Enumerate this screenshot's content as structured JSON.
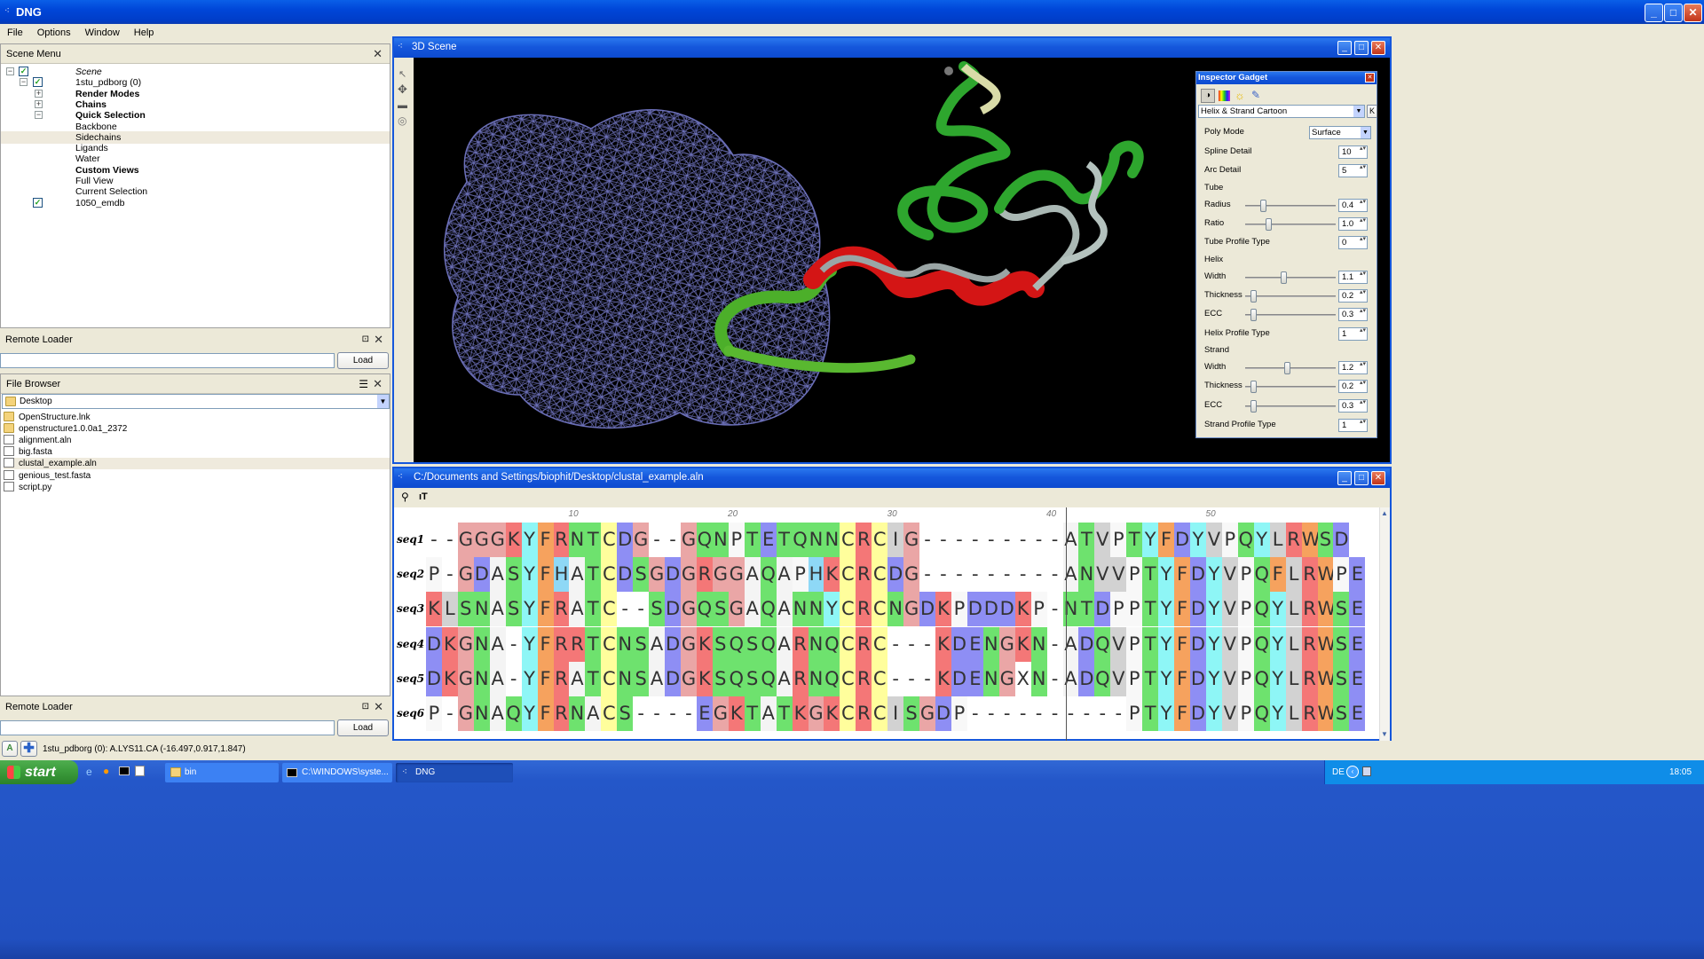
{
  "app_title": "DNG",
  "menu": [
    "File",
    "Options",
    "Window",
    "Help"
  ],
  "scene_menu": {
    "title": "Scene Menu",
    "items": [
      {
        "label": "Scene",
        "style": "italic",
        "indent": 0,
        "expander": "−",
        "check": true
      },
      {
        "label": "1stu_pdborg (0)",
        "style": "normal",
        "indent": 1,
        "expander": "−",
        "check": true
      },
      {
        "label": "Render Modes",
        "style": "bold",
        "indent": 2,
        "expander": "+",
        "check": false
      },
      {
        "label": "Chains",
        "style": "bold",
        "indent": 2,
        "expander": "+",
        "check": false
      },
      {
        "label": "Quick Selection",
        "style": "bold",
        "indent": 2,
        "expander": "−",
        "check": false
      },
      {
        "label": "Backbone",
        "style": "normal",
        "indent": 3,
        "expander": "",
        "check": false
      },
      {
        "label": "Sidechains",
        "style": "normal",
        "indent": 3,
        "expander": "",
        "check": false,
        "selected": true
      },
      {
        "label": "Ligands",
        "style": "normal",
        "indent": 3,
        "expander": "",
        "check": false
      },
      {
        "label": "Water",
        "style": "normal",
        "indent": 3,
        "expander": "",
        "check": false
      },
      {
        "label": "Custom Views",
        "style": "bold",
        "indent": 2,
        "expander": "",
        "check": false
      },
      {
        "label": "Full View",
        "style": "normal",
        "indent": 2,
        "expander": "",
        "check": false
      },
      {
        "label": "Current Selection",
        "style": "normal",
        "indent": 2,
        "expander": "",
        "check": false
      },
      {
        "label": "1050_emdb",
        "style": "normal",
        "indent": 1,
        "expander": "",
        "check": true
      }
    ]
  },
  "remote_loader_1": {
    "title": "Remote Loader",
    "value": "",
    "button": "Load"
  },
  "file_browser": {
    "title": "File Browser",
    "location": "Desktop",
    "files": [
      {
        "name": "OpenStructure.lnk",
        "type": "folder"
      },
      {
        "name": "openstructure1.0.0a1_2372",
        "type": "folder"
      },
      {
        "name": "alignment.aln",
        "type": "doc"
      },
      {
        "name": "big.fasta",
        "type": "doc"
      },
      {
        "name": "clustal_example.aln",
        "type": "doc",
        "selected": true
      },
      {
        "name": "genious_test.fasta",
        "type": "doc"
      },
      {
        "name": "script.py",
        "type": "doc"
      }
    ]
  },
  "remote_loader_2": {
    "title": "Remote Loader",
    "value": "",
    "button": "Load"
  },
  "status_text": "1stu_pdborg (0): A.LYS11.CA (-16.497,0.917,1.847)",
  "scene_3d": {
    "title": "3D Scene"
  },
  "inspector": {
    "title": "Inspector Gadget",
    "render_mode": "Helix & Strand Cartoon",
    "k_button": "K",
    "rows": [
      {
        "label": "Poly Mode",
        "kind": "select",
        "value": "Surface"
      },
      {
        "label": "Spline Detail",
        "kind": "spin",
        "value": "10"
      },
      {
        "label": "Arc Detail",
        "kind": "spin",
        "value": "5"
      },
      {
        "label": "Tube",
        "kind": "header"
      },
      {
        "label": "Radius",
        "kind": "slider",
        "value": "0.4",
        "pos": 0.18
      },
      {
        "label": "Ratio",
        "kind": "slider",
        "value": "1.0",
        "pos": 0.24
      },
      {
        "label": "Tube Profile Type",
        "kind": "spin",
        "value": "0"
      },
      {
        "label": "Helix",
        "kind": "header"
      },
      {
        "label": "Width",
        "kind": "slider",
        "value": "1.1",
        "pos": 0.42
      },
      {
        "label": "Thickness",
        "kind": "slider",
        "value": "0.2",
        "pos": 0.06
      },
      {
        "label": "ECC",
        "kind": "slider",
        "value": "0.3",
        "pos": 0.06
      },
      {
        "label": "Helix Profile Type",
        "kind": "spin",
        "value": "1"
      },
      {
        "label": "Strand",
        "kind": "header"
      },
      {
        "label": "Width",
        "kind": "slider",
        "value": "1.2",
        "pos": 0.46
      },
      {
        "label": "Thickness",
        "kind": "slider",
        "value": "0.2",
        "pos": 0.06
      },
      {
        "label": "ECC",
        "kind": "slider",
        "value": "0.3",
        "pos": 0.06
      },
      {
        "label": "Strand Profile Type",
        "kind": "spin",
        "value": "1"
      }
    ]
  },
  "alignment": {
    "title": "C:/Documents and Settings/biophit/Desktop/clustal_example.aln",
    "ruler": [
      "10",
      "20",
      "30",
      "40",
      "50"
    ],
    "sequences": [
      {
        "name": "seq1",
        "residues": "--GGGKYFRNTCDG--GQNPTETQNNCRCIG---------ATVPTYFDYVPQYLRWSD"
      },
      {
        "name": "seq2",
        "residues": "P-GDASYFHATCDSGDGRGGAQAPHKCRCDG---------ANVVPTYFDYVPQFLRWPE"
      },
      {
        "name": "seq3",
        "residues": "KLSNASYFRATC--SDGQSGAQANNYCRCNGDKPDDDKP-NTDPPTYFDYVPQYLRWSE"
      },
      {
        "name": "seq4",
        "residues": "DKGNA-YFRRTCNSADGKSQSQARNQCRC---KDENGKN-ADQVPTYFDYVPQYLRWSE"
      },
      {
        "name": "seq5",
        "residues": "DKGNA-YFRATCNSADGKSQSQARNQCRC---KDENGXN-ADQVPTYFDYVPQYLRWSE"
      },
      {
        "name": "seq6",
        "residues": "P-GNAQYFRNACS----EGKTATKGKCRCISGDP----------PTYFDYVPQYLRWSE"
      }
    ]
  },
  "residue_colors": {
    "A": "#f4f4f4",
    "G": "#eaa6a6",
    "C": "#fffe9c",
    "D": "#8e8ef4",
    "E": "#8e8ef4",
    "N": "#6ee26e",
    "Q": "#6ee26e",
    "S": "#6ee26e",
    "T": "#6ee26e",
    "K": "#f47777",
    "R": "#f47777",
    "H": "#8ed8f6",
    "Y": "#8ef6f6",
    "F": "#f6a25e",
    "W": "#f6a25e",
    "L": "#d2d2d2",
    "I": "#d2d2d2",
    "V": "#d2d2d2",
    "M": "#d2d2d2",
    "P": "#f8f8f8",
    "X": "#ffffff",
    "-": "#ffffff"
  },
  "taskbar": {
    "start": "start",
    "tasks": [
      "bin",
      "C:\\WINDOWS\\syste...",
      "DNG"
    ],
    "lang": "DE",
    "clock": "18:05"
  }
}
